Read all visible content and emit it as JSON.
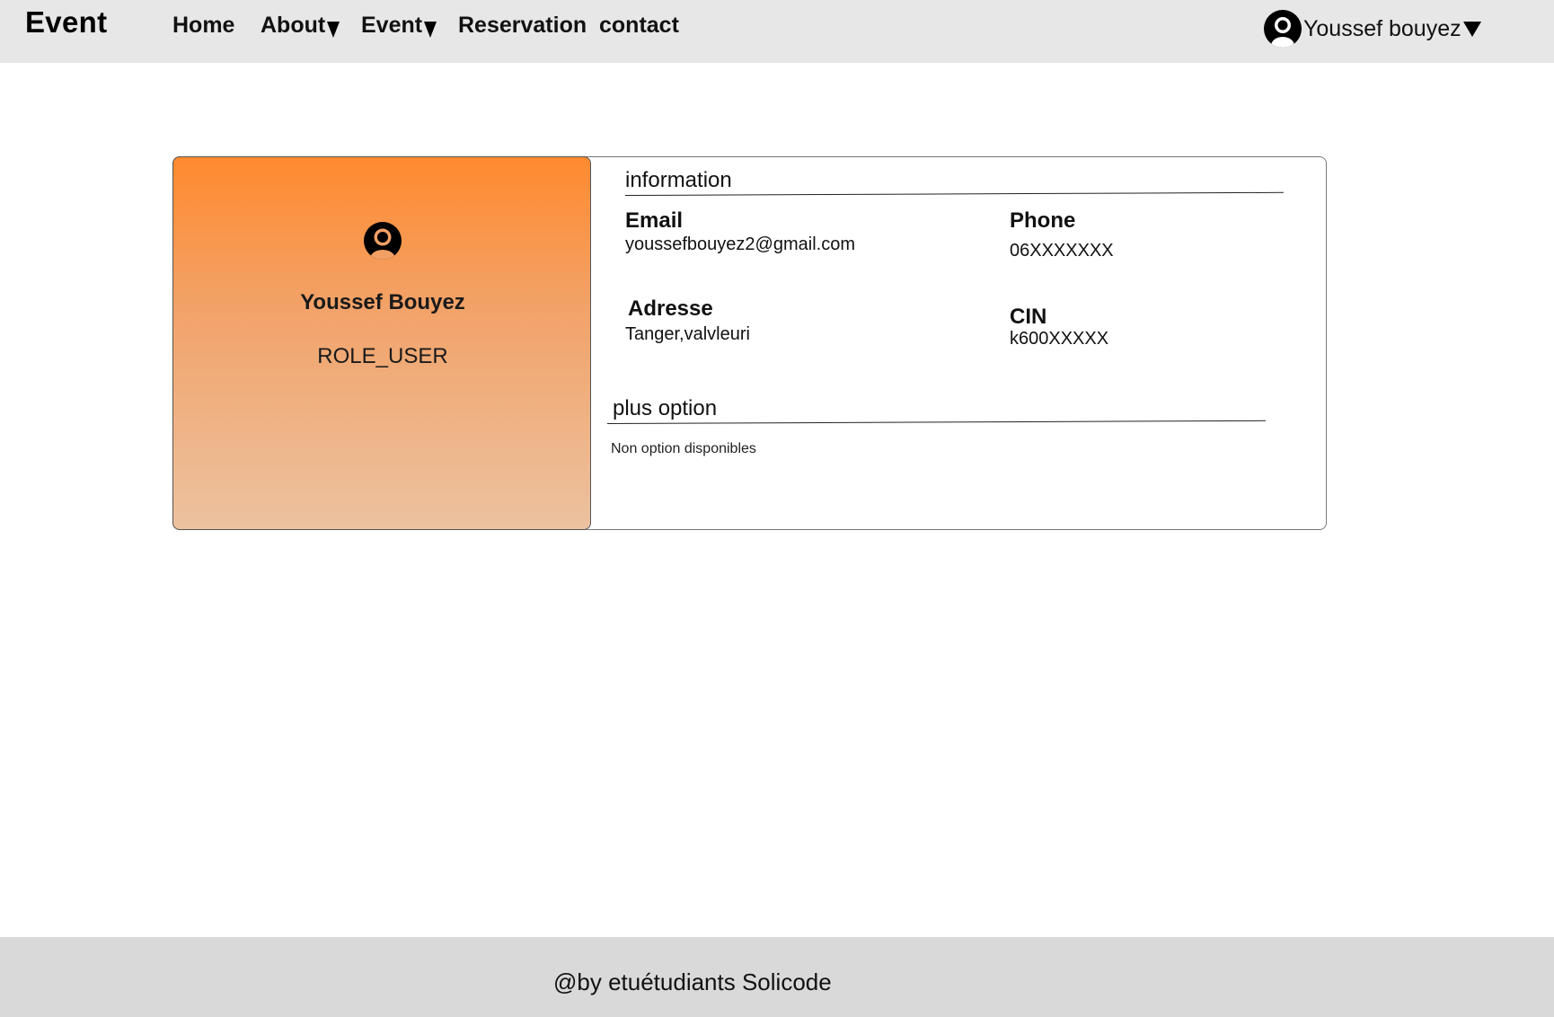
{
  "header": {
    "brand": "Event",
    "nav": {
      "home": "Home",
      "about": "About",
      "event": "Event",
      "reservation": "Reservation",
      "contact": "contact"
    },
    "user_menu": {
      "name": "Youssef bouyez",
      "icon": "user-circle-icon"
    }
  },
  "profile": {
    "name": "Youssef Bouyez",
    "role": "ROLE_USER",
    "avatar_icon": "user-circle-icon",
    "gradient_colors": [
      "#ff8a2e",
      "#ecc2a0"
    ]
  },
  "information": {
    "title": "information",
    "email": {
      "label": "Email",
      "value": "youssefbouyez2@gmail.com"
    },
    "phone": {
      "label": "Phone",
      "value": "06XXXXXXX"
    },
    "adresse": {
      "label": "Adresse",
      "value": "Tanger,valvleuri"
    },
    "cin": {
      "label": "CIN",
      "value": "k600XXXXX"
    }
  },
  "options": {
    "title": "plus option",
    "empty_text": "Non option disponibles"
  },
  "footer": {
    "text": "@by etuétudiants Solicode"
  }
}
